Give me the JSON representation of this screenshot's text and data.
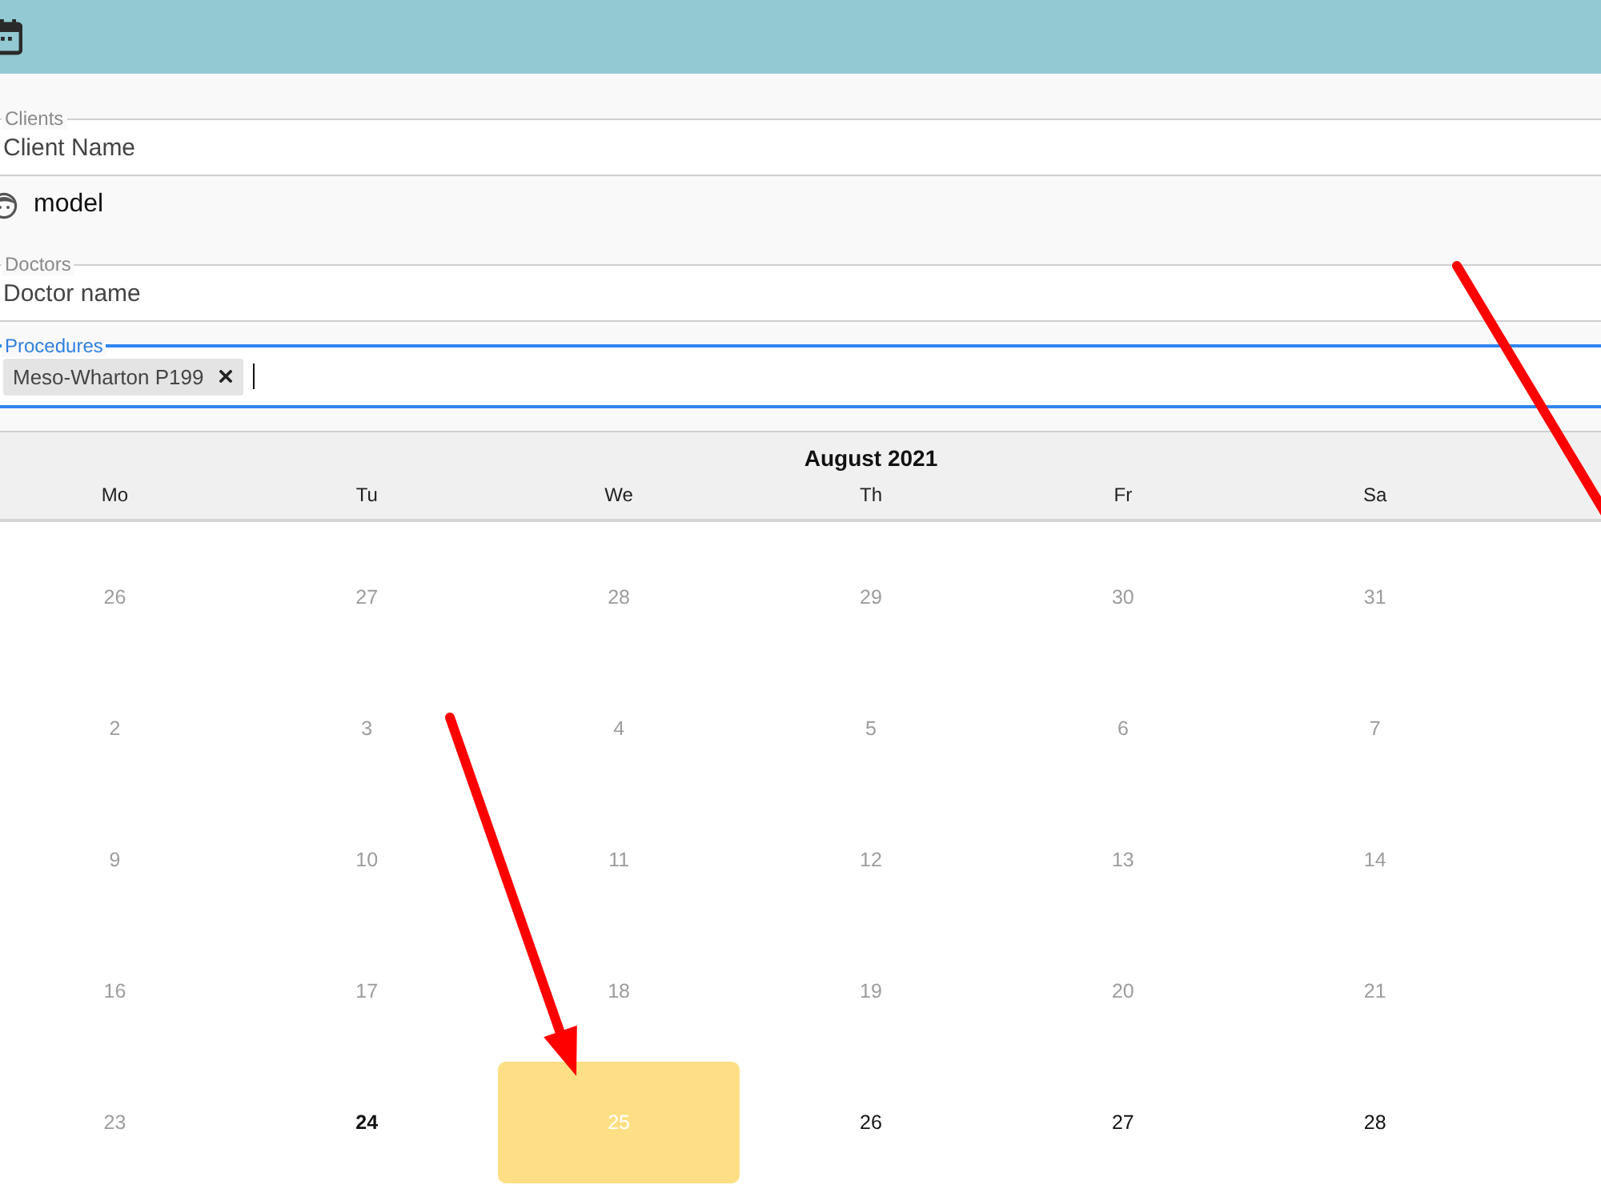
{
  "form": [
    {
      "kind": "input",
      "legend": "Clients",
      "placeholder": "Client Name",
      "focused": false
    },
    {
      "kind": "option",
      "label": "model"
    },
    {
      "kind": "input",
      "legend": "Doctors",
      "placeholder": "Doctor name",
      "focused": false
    },
    {
      "kind": "tags",
      "legend": "Procedures",
      "focused": true,
      "tags": [
        {
          "label": "Meso-Wharton P199"
        }
      ]
    }
  ],
  "calendar": {
    "title": "August 2021",
    "weekdays": [
      "Mo",
      "Tu",
      "We",
      "Th",
      "Fr",
      "Sa"
    ],
    "weeks": [
      [
        {
          "label": "26",
          "disabled": true,
          "today": false,
          "selected": false
        },
        {
          "label": "27",
          "disabled": true,
          "today": false,
          "selected": false
        },
        {
          "label": "28",
          "disabled": true,
          "today": false,
          "selected": false
        },
        {
          "label": "29",
          "disabled": true,
          "today": false,
          "selected": false
        },
        {
          "label": "30",
          "disabled": true,
          "today": false,
          "selected": false
        },
        {
          "label": "31",
          "disabled": true,
          "today": false,
          "selected": false
        }
      ],
      [
        {
          "label": "2",
          "disabled": true,
          "today": false,
          "selected": false
        },
        {
          "label": "3",
          "disabled": true,
          "today": false,
          "selected": false
        },
        {
          "label": "4",
          "disabled": true,
          "today": false,
          "selected": false
        },
        {
          "label": "5",
          "disabled": true,
          "today": false,
          "selected": false
        },
        {
          "label": "6",
          "disabled": true,
          "today": false,
          "selected": false
        },
        {
          "label": "7",
          "disabled": true,
          "today": false,
          "selected": false
        }
      ],
      [
        {
          "label": "9",
          "disabled": true,
          "today": false,
          "selected": false
        },
        {
          "label": "10",
          "disabled": true,
          "today": false,
          "selected": false
        },
        {
          "label": "11",
          "disabled": true,
          "today": false,
          "selected": false
        },
        {
          "label": "12",
          "disabled": true,
          "today": false,
          "selected": false
        },
        {
          "label": "13",
          "disabled": true,
          "today": false,
          "selected": false
        },
        {
          "label": "14",
          "disabled": true,
          "today": false,
          "selected": false
        }
      ],
      [
        {
          "label": "16",
          "disabled": true,
          "today": false,
          "selected": false
        },
        {
          "label": "17",
          "disabled": true,
          "today": false,
          "selected": false
        },
        {
          "label": "18",
          "disabled": true,
          "today": false,
          "selected": false
        },
        {
          "label": "19",
          "disabled": true,
          "today": false,
          "selected": false
        },
        {
          "label": "20",
          "disabled": true,
          "today": false,
          "selected": false
        },
        {
          "label": "21",
          "disabled": true,
          "today": false,
          "selected": false
        }
      ],
      [
        {
          "label": "23",
          "disabled": true,
          "today": false,
          "selected": false
        },
        {
          "label": "24",
          "disabled": false,
          "today": true,
          "selected": false
        },
        {
          "label": "25",
          "disabled": false,
          "today": false,
          "selected": true
        },
        {
          "label": "26",
          "disabled": false,
          "today": false,
          "selected": false
        },
        {
          "label": "27",
          "disabled": false,
          "today": false,
          "selected": false
        },
        {
          "label": "28",
          "disabled": false,
          "today": false,
          "selected": false
        }
      ]
    ]
  }
}
